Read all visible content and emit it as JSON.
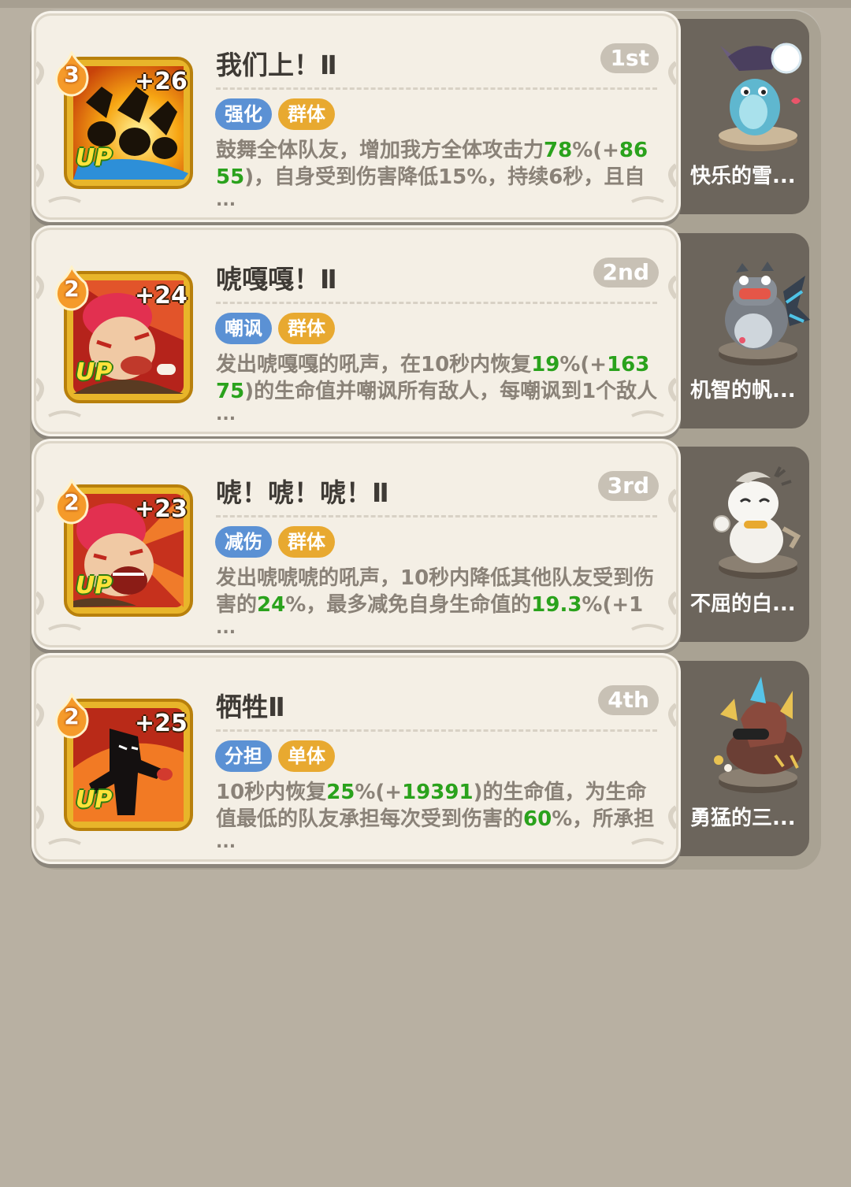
{
  "colors": {
    "highlight_green": "#2aa21c",
    "tag_blue": "#5b91d4",
    "tag_gold": "#e8a930"
  },
  "skills": [
    {
      "title": "我们上！Ⅱ",
      "rank": "1st",
      "level": "3",
      "plus": "+26",
      "up": "UP",
      "tags": [
        "强化",
        "群体"
      ],
      "desc": [
        "鼓舞全体队友，增加我方全体攻击力",
        "78",
        "%(+",
        "8655",
        ")，自身受到伤害降低15%，持续6秒，且自"
      ],
      "ellipsis": "...",
      "pet_name": "快乐的雪...",
      "icon": "raised-fist-crowd-icon",
      "pet_icon": "blue-bunny-snowball-figure"
    },
    {
      "title": "唬嘎嘎！Ⅱ",
      "rank": "2nd",
      "level": "2",
      "plus": "+24",
      "up": "UP",
      "tags": [
        "嘲讽",
        "群体"
      ],
      "desc": [
        "发出唬嘎嘎的吼声，在10秒内恢复",
        "19",
        "%(+",
        "16375",
        ")的生命值并嘲讽所有敌人，每嘲讽到1个敌人"
      ],
      "ellipsis": "...",
      "pet_name": "机智的帆...",
      "icon": "red-hair-shouting-warrior-icon",
      "pet_icon": "grey-dragon-sailor-figure"
    },
    {
      "title": "唬！唬！唬！Ⅱ",
      "rank": "3rd",
      "level": "2",
      "plus": "+23",
      "up": "UP",
      "tags": [
        "减伤",
        "群体"
      ],
      "desc": [
        "发出唬唬唬的吼声，10秒内降低其他队友受到伤害的",
        "24",
        "%，最多减免自身生命值的",
        "19.3",
        "%(+1"
      ],
      "ellipsis": "...",
      "pet_name": "不屈的白...",
      "icon": "red-hair-roaring-warrior-icon",
      "pet_icon": "white-goat-thumbs-up-figure"
    },
    {
      "title": "牺牲Ⅱ",
      "rank": "4th",
      "level": "2",
      "plus": "+25",
      "up": "UP",
      "tags": [
        "分担",
        "单体"
      ],
      "desc": [
        "10秒内恢复",
        "25",
        "%(+",
        "19391",
        ")的生命值，为生命值最低的队友承担每次受到伤害的",
        "60",
        "%，所承担"
      ],
      "ellipsis": "...",
      "pet_name": "勇猛的三...",
      "icon": "shadow-fighter-punch-icon",
      "pet_icon": "triceratops-figure"
    }
  ]
}
